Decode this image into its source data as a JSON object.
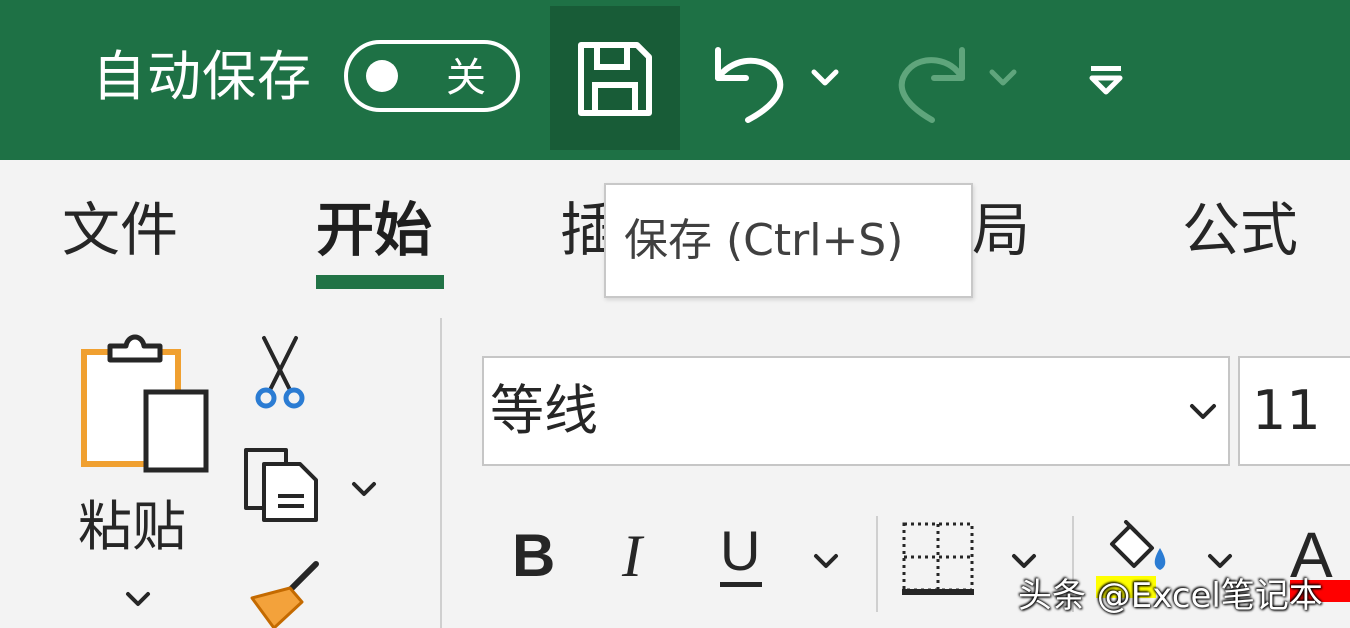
{
  "quick_access": {
    "autosave_label": "自动保存",
    "autosave_state": "关",
    "save_icon": "save-icon",
    "undo_icon": "undo-icon",
    "redo_icon": "redo-icon",
    "customize_icon": "customize-toolbar-icon"
  },
  "tabs": [
    {
      "label": "文件",
      "active": false
    },
    {
      "label": "开始",
      "active": true
    },
    {
      "label": "插",
      "active": false
    },
    {
      "label": "局",
      "active": false
    },
    {
      "label": "公式",
      "active": false
    }
  ],
  "tooltip": {
    "text": "保存 (Ctrl+S)"
  },
  "clipboard": {
    "paste_label": "粘贴",
    "paste_icon": "paste-icon",
    "cut_icon": "scissors-icon",
    "copy_icon": "copy-icon",
    "format_painter_icon": "format-painter-icon"
  },
  "font": {
    "name": "等线",
    "size": "11",
    "bold_label": "B",
    "italic_label": "I",
    "underline_label": "U",
    "font_color_label": "A",
    "highlight_color": "#ffff00",
    "font_color": "#ff0000"
  },
  "watermark": {
    "text": "头条 @Excel笔记本"
  },
  "colors": {
    "title_bar": "#1e7145",
    "save_button_hover": "#185c37",
    "active_tab_underline": "#217346"
  }
}
